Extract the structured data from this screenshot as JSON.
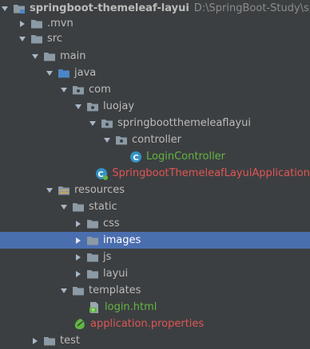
{
  "colors": {
    "background": "#3c3f41",
    "selection": "#4b6eaf",
    "text": "#bbbbbb",
    "class_text": "#62b543",
    "error_text": "#e05555",
    "folder": "#8b9aa5",
    "source_folder": "#4a86c8",
    "package": "#8b9aa5"
  },
  "tree": {
    "project": {
      "name": "springboot-themeleaf-layui",
      "path": "D:\\SpringBoot-Study\\springbo"
    },
    "mvn": {
      "label": ".mvn"
    },
    "src": {
      "label": "src"
    },
    "main": {
      "label": "main"
    },
    "java": {
      "label": "java"
    },
    "com": {
      "label": "com"
    },
    "luojay": {
      "label": "luojay"
    },
    "pkg": {
      "label": "springbootthemeleaflayui"
    },
    "controller": {
      "label": "controller"
    },
    "login_controller": {
      "label": "LoginController"
    },
    "application": {
      "label": "SpringbootThemeleafLayuiApplication"
    },
    "resources": {
      "label": "resources"
    },
    "static": {
      "label": "static"
    },
    "css": {
      "label": "css"
    },
    "images": {
      "label": "images"
    },
    "js": {
      "label": "js"
    },
    "layui": {
      "label": "layui"
    },
    "templates": {
      "label": "templates"
    },
    "login_html": {
      "label": "login.html"
    },
    "app_props": {
      "label": "application.properties"
    },
    "test": {
      "label": "test"
    }
  }
}
